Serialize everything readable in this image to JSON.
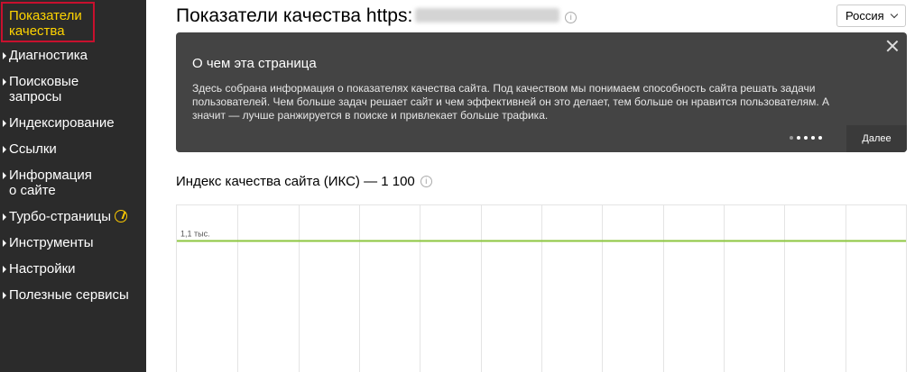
{
  "sidebar": {
    "active_item": "Показатели\nкачества",
    "items": [
      {
        "label": "Диагностика"
      },
      {
        "label": "Поисковые\nзапросы"
      },
      {
        "label": "Индексирование"
      },
      {
        "label": "Ссылки"
      },
      {
        "label": "Информация\nо сайте"
      },
      {
        "label": "Турбо-страницы",
        "icon": "turbo-icon"
      },
      {
        "label": "Инструменты"
      },
      {
        "label": "Настройки"
      },
      {
        "label": "Полезные сервисы"
      }
    ]
  },
  "header": {
    "title": "Показатели качества https:",
    "region": "Россия"
  },
  "banner": {
    "title": "О чем эта страница",
    "text": "Здесь собрана информация о показателях качества сайта. Под качеством мы понимаем способность сайта решать задачи пользователей. Чем больше задач решает сайт и чем эффективней он это делает, тем больше он нравится пользователям. А значит — лучше ранжируется в поиске и привлекает больше трафика.",
    "next_label": "Далее",
    "pager": {
      "total": 5,
      "current": 1
    }
  },
  "index": {
    "title": "Индекс качества сайта (ИКС) — 1 100"
  },
  "chart_data": {
    "type": "line",
    "series": [
      {
        "values": [
          1100,
          1100
        ]
      }
    ],
    "y_tick_labels": [
      "1,1 тыс."
    ],
    "x_gridlines": 12,
    "line_color": "#8cc63f"
  }
}
